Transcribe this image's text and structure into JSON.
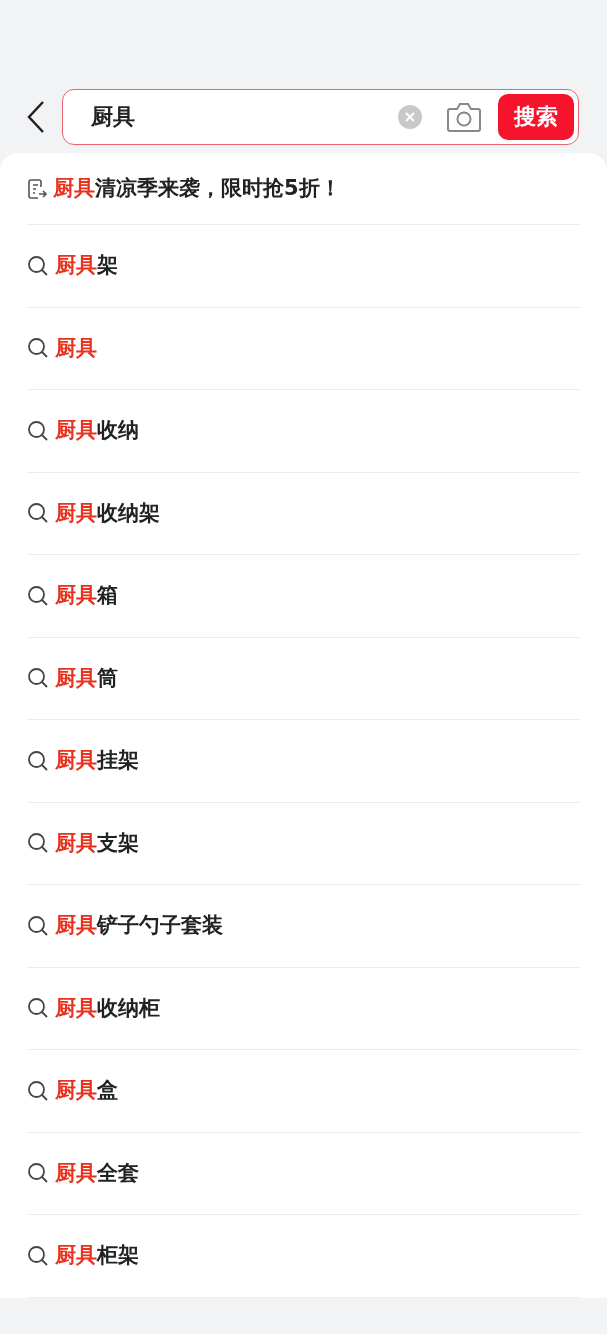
{
  "search": {
    "value": "厨具",
    "button": "搜索"
  },
  "suggestions": [
    {
      "kind": "promo",
      "match": "厨具",
      "rest": "清凉季来袭，限时抢5折！"
    },
    {
      "kind": "query",
      "match": "厨具",
      "rest": "架"
    },
    {
      "kind": "query",
      "match": "厨具"
    },
    {
      "kind": "query",
      "match": "厨具",
      "rest": "收纳"
    },
    {
      "kind": "query",
      "match": "厨具",
      "rest": "收纳架"
    },
    {
      "kind": "query",
      "match": "厨具",
      "rest": "箱"
    },
    {
      "kind": "query",
      "match": "厨具",
      "rest": "筒"
    },
    {
      "kind": "query",
      "match": "厨具",
      "rest": "挂架"
    },
    {
      "kind": "query",
      "match": "厨具",
      "rest": "支架"
    },
    {
      "kind": "query",
      "match": "厨具",
      "rest": "铲子勺子套装"
    },
    {
      "kind": "query",
      "match": "厨具",
      "rest": "收纳柜"
    },
    {
      "kind": "query",
      "match": "厨具",
      "rest": "盒"
    },
    {
      "kind": "query",
      "match": "厨具",
      "rest": "全套"
    },
    {
      "kind": "query",
      "match": "厨具",
      "rest": "柜架"
    }
  ]
}
